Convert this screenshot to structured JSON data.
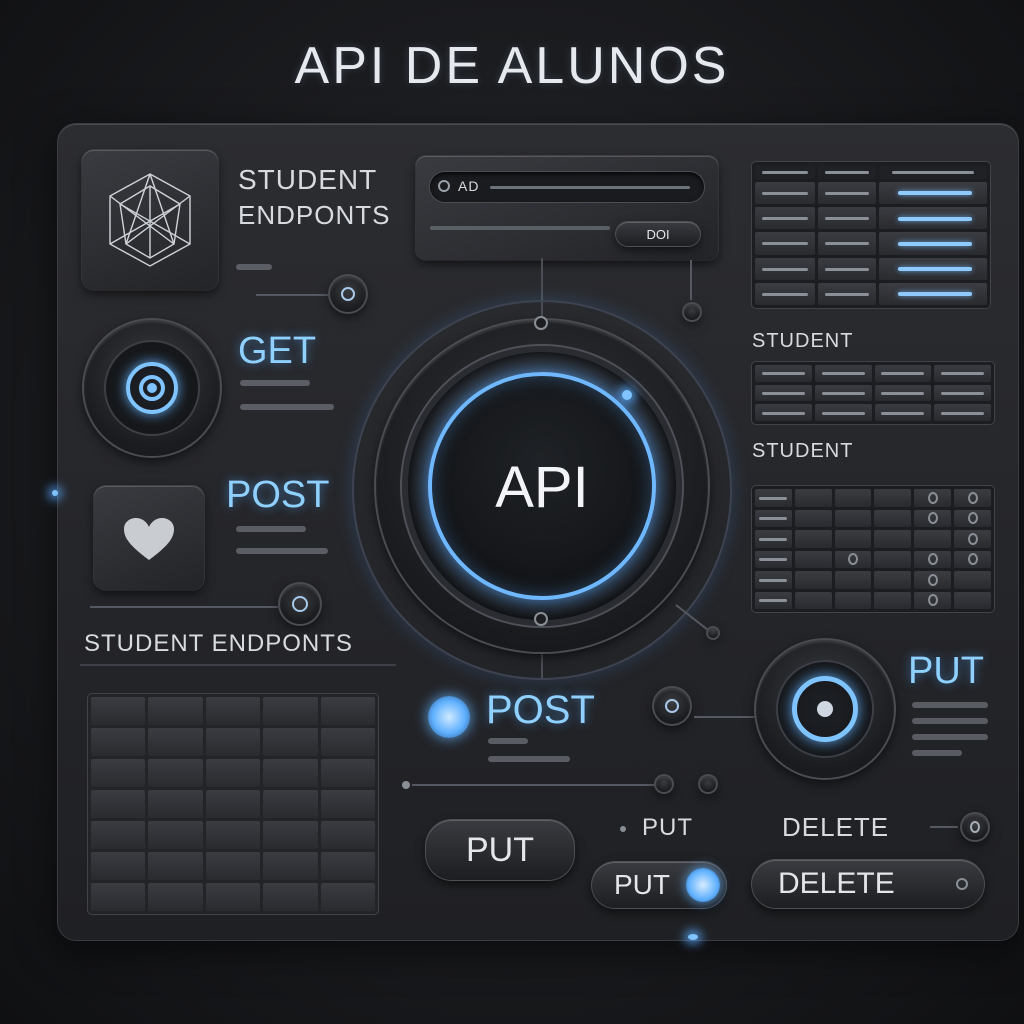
{
  "header": {
    "title": "API DE ALUNOS"
  },
  "top_left": {
    "title_line1": "STUDENT",
    "title_line2": "ENDPONTS"
  },
  "search": {
    "field_text": "AD",
    "button_label": "DOI"
  },
  "center": {
    "label": "API"
  },
  "left_methods": {
    "get": "GET",
    "post": "POST"
  },
  "section": {
    "student_endpoints": "STUDENT ENDPONTS"
  },
  "right_tables": {
    "title1": "STUDENT",
    "title2": "STUDENT"
  },
  "middle": {
    "post": "POST"
  },
  "right_put": {
    "label": "PUT"
  },
  "buttons": {
    "put_large": "PUT",
    "put_small": "PUT",
    "put_text": "PUT",
    "delete_text": "DELETE",
    "delete_button": "DELETE"
  },
  "colors": {
    "accent": "#7fc4ff",
    "background": "#1a1b1e",
    "panel": "#2a2b2f"
  }
}
